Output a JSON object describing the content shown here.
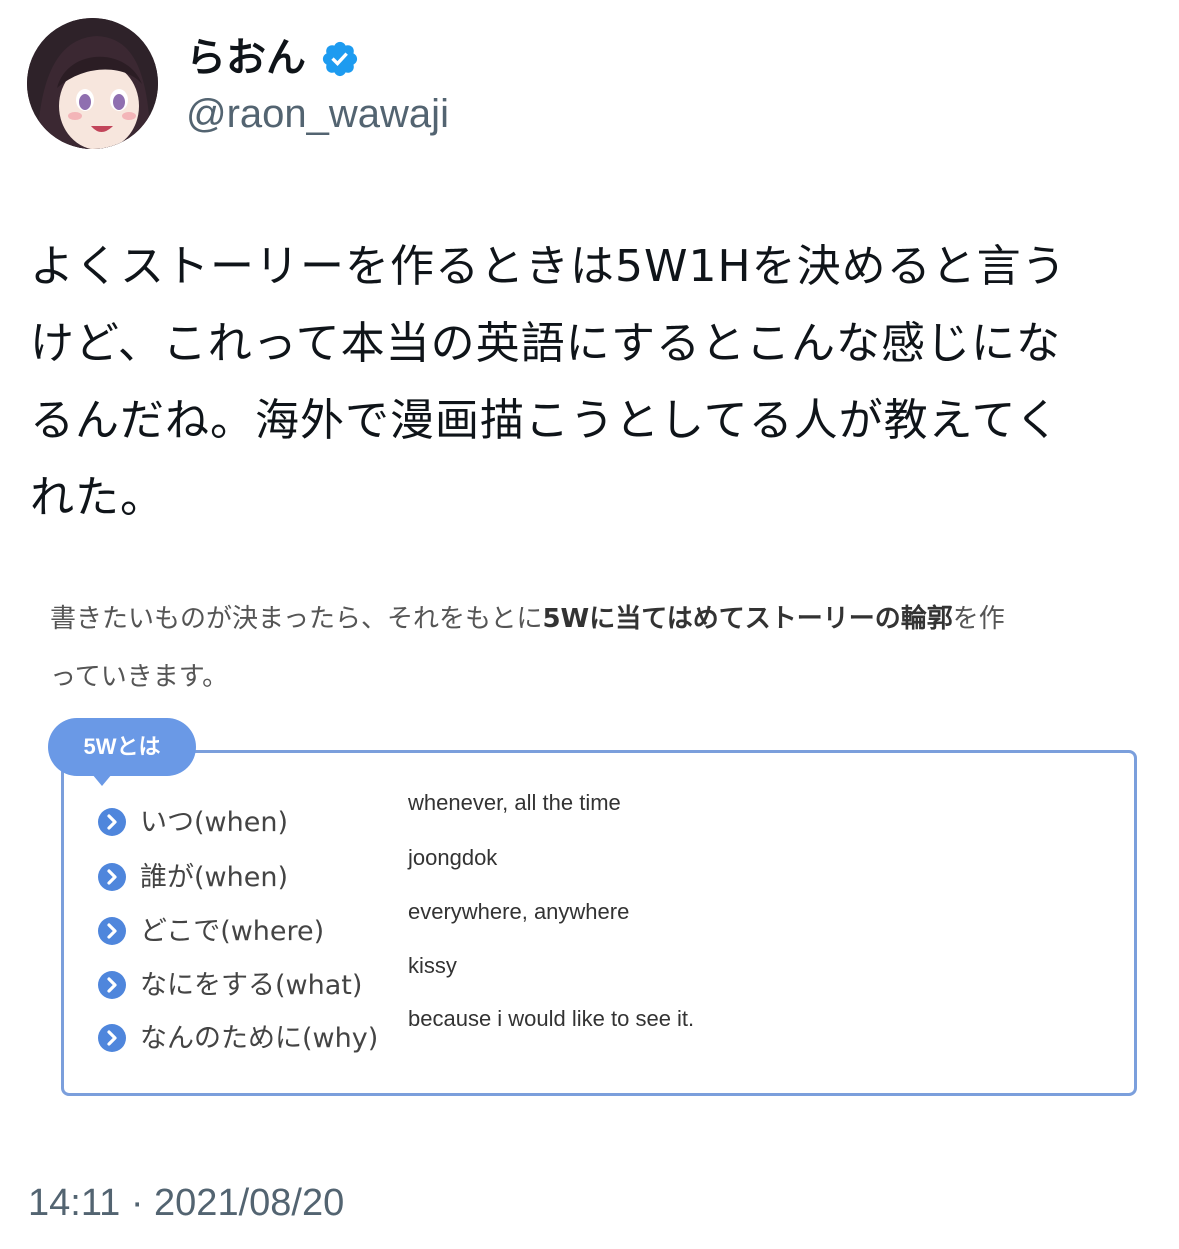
{
  "author": {
    "display_name": "らおん",
    "handle": "@raon_wawaji",
    "avatar_icon": "user-avatar-icon",
    "verified_icon": "verified-badge-icon"
  },
  "tweet": {
    "text_lines": [
      "よくストーリーを作るときは5W1Hを決めると言う",
      "けど、これって本当の英語にするとこんな感じにな",
      "るんだね。海外で漫画描こうとしてる人が教えてく",
      "れた。"
    ],
    "timestamp": "14:11 · 2021/08/20"
  },
  "media": {
    "intro_line1_part1": "書きたいものが決まったら、それをもとに",
    "intro_line1_bold": "5Wに当てはめてストーリーの輪郭",
    "intro_line1_part2": "を作",
    "intro_line2": "っていきます。",
    "box_label": "5Wとは",
    "rows": [
      {
        "question": "いつ(when)",
        "answer": "whenever, all the time"
      },
      {
        "question": "誰が(when)",
        "answer": "joongdok"
      },
      {
        "question": "どこで(where)",
        "answer": "everywhere, anywhere"
      },
      {
        "question": "なにをする(what)",
        "answer": "kissy"
      },
      {
        "question": "なんのために(why)",
        "answer": "because i would like to see it."
      }
    ],
    "colors": {
      "accent": "#6a99e6",
      "border": "#7b9fdc"
    }
  }
}
